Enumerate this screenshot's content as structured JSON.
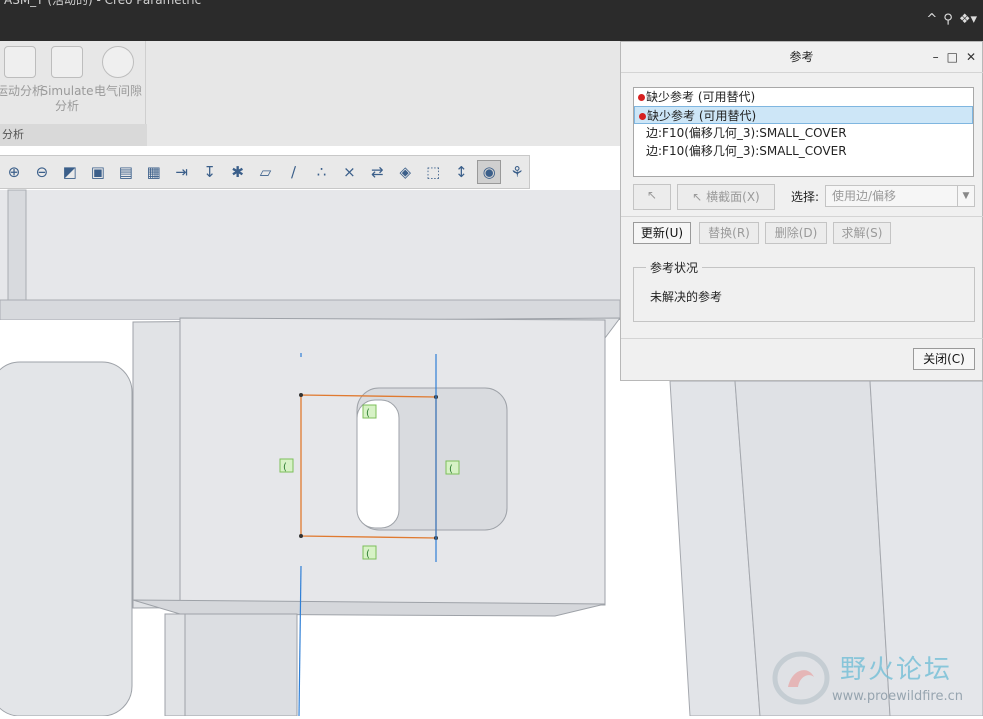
{
  "window": {
    "title": "ASM_T (活动的) - Creo Parametric"
  },
  "ribbon": {
    "groups": [
      {
        "icon": "gear-icon",
        "label": "运动分析"
      },
      {
        "icon": "simulate-icon",
        "label": "Simulate 分析"
      },
      {
        "icon": "electric-clearance-icon",
        "label": "电气间隙"
      }
    ],
    "group_label": "分析"
  },
  "toolbar": {
    "icons": [
      "zoom-in-icon",
      "zoom-out-icon",
      "refit-icon",
      "view-orient-icon",
      "saved-views-icon",
      "display-style-icon",
      "appearance-icon",
      "spin-center-icon",
      "datum-display-icon",
      "plane-display-icon",
      "axis-display-icon",
      "point-display-icon",
      "csys-display-icon",
      "annotation-display-icon",
      "section-icon",
      "perspective-icon",
      "dimension-display-icon",
      "reference-display-icon",
      "sketch-display-icon"
    ]
  },
  "dialog": {
    "title": "参考",
    "list_items": [
      {
        "text": "缺少参考 (可用替代)",
        "missing": true,
        "selected": false
      },
      {
        "text": "缺少参考 (可用替代)",
        "missing": true,
        "selected": true
      },
      {
        "text": "边:F10(偏移几何_3):SMALL_COVER",
        "missing": false,
        "selected": false
      },
      {
        "text": "边:F10(偏移几何_3):SMALL_COVER",
        "missing": false,
        "selected": false
      }
    ],
    "cross_section_label": "横截面(X)",
    "select_label": "选择:",
    "select_value": "使用边/偏移",
    "update_label": "更新(U)",
    "replace_label": "替换(R)",
    "delete_label": "删除(D)",
    "solve_label": "求解(S)",
    "status_group_label": "参考状况",
    "status_text": "未解决的参考",
    "close_label": "关闭(C)"
  },
  "watermark": {
    "title": "野火论坛",
    "url": "www.proewildfire.cn"
  },
  "colors": {
    "sketch_orange": "#e07a30",
    "datum_blue": "#2f7fd6",
    "missing_red": "#d62020",
    "selection_blue": "#cde6f7"
  }
}
